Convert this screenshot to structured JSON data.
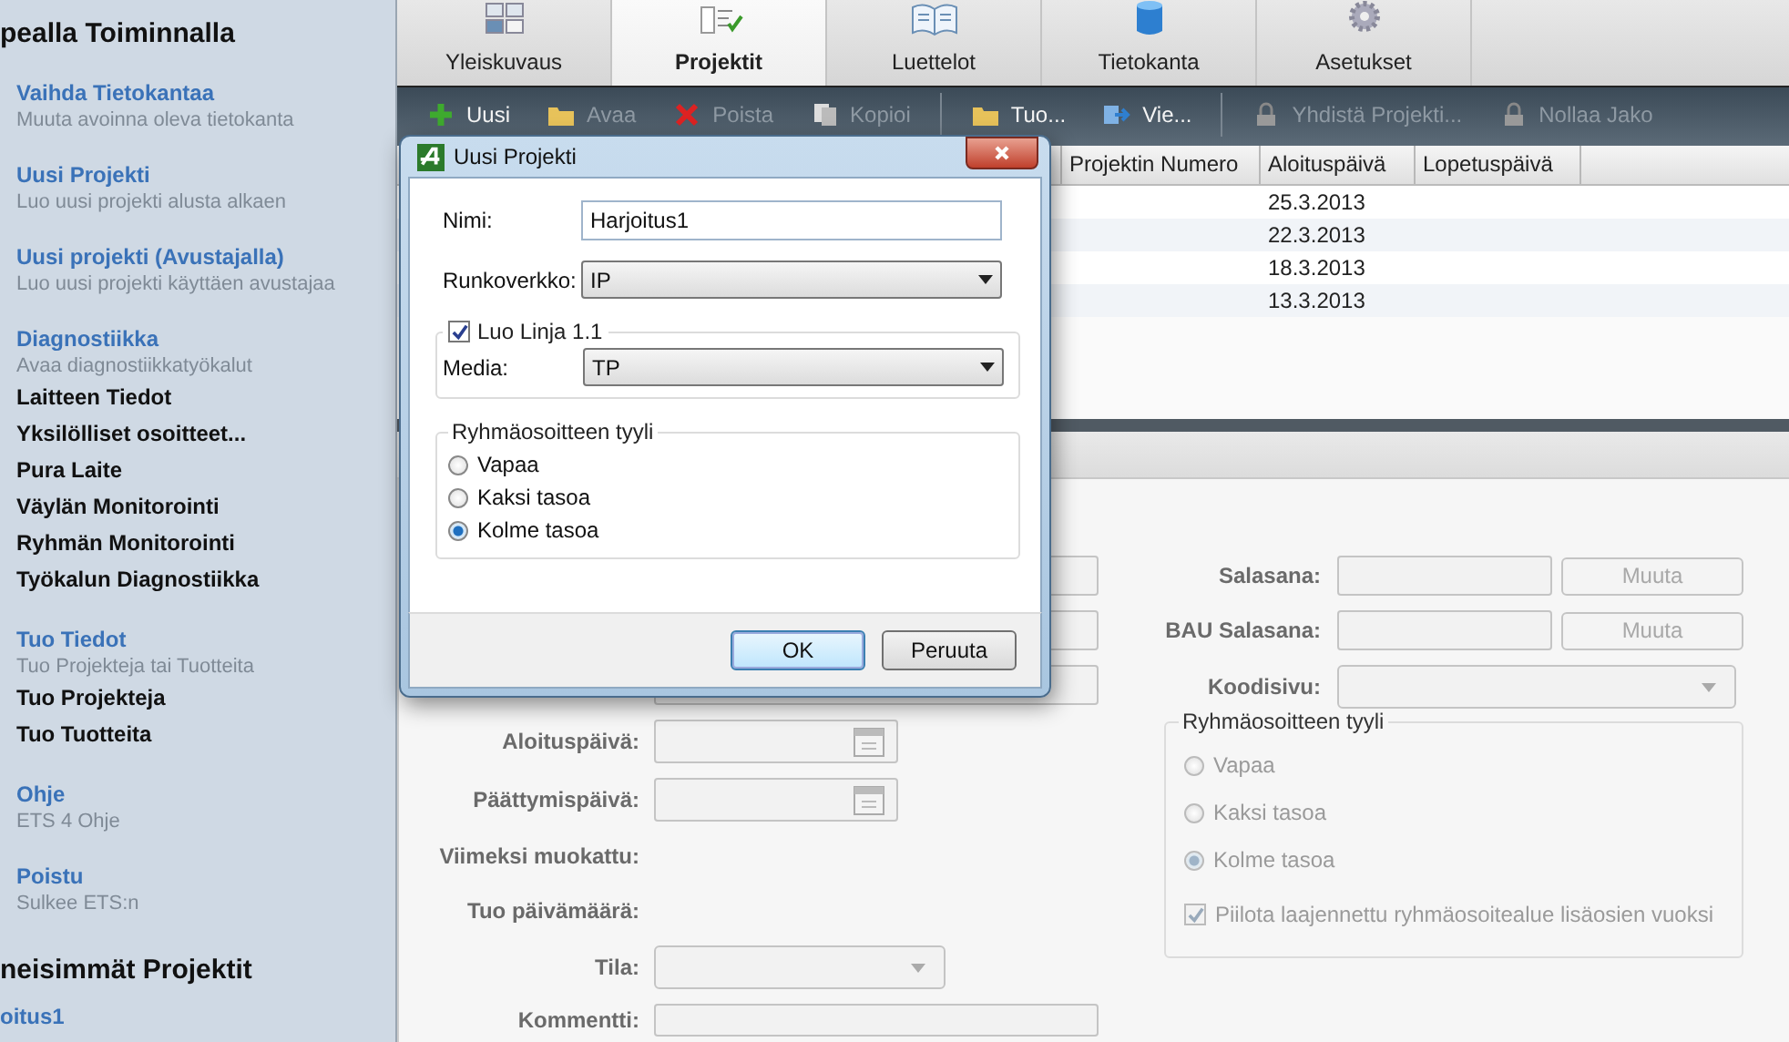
{
  "sidebar": {
    "heading": "pealla Toiminnalla",
    "sections": [
      {
        "title": "Vaihda Tietokantaa",
        "description": "Muuta avoinna oleva tietokanta"
      },
      {
        "title": "Uusi Projekti",
        "description": "Luo uusi projekti alusta alkaen"
      },
      {
        "title": "Uusi projekti (Avustajalla)",
        "description": "Luo uusi projekti käyttäen avustajaa"
      },
      {
        "title": "Diagnostiikka",
        "description": "Avaa diagnostiikkatyökalut",
        "items": [
          "Laitteen Tiedot",
          "Yksilölliset osoitteet...",
          "Pura Laite",
          "Väylän Monitorointi",
          "Ryhmän Monitorointi",
          "Työkalun Diagnostiikka"
        ]
      },
      {
        "title": "Tuo Tiedot",
        "description": "Tuo Projekteja tai Tuotteita",
        "items": [
          "Tuo Projekteja",
          "Tuo Tuotteita"
        ]
      },
      {
        "title": "Ohje",
        "description": "ETS 4 Ohje"
      },
      {
        "title": "Poistu",
        "description": "Sulkee ETS:n"
      }
    ],
    "recent_heading": "neisimmät Projektit",
    "recent_projects": [
      "oitus1"
    ]
  },
  "tabs": [
    {
      "label": "Yleiskuvaus",
      "selected": false
    },
    {
      "label": "Projektit",
      "selected": true
    },
    {
      "label": "Luettelot",
      "selected": false
    },
    {
      "label": "Tietokanta",
      "selected": false
    },
    {
      "label": "Asetukset",
      "selected": false
    }
  ],
  "toolbar": {
    "groups": [
      [
        {
          "label": "Uusi",
          "disabled": false
        },
        {
          "label": "Avaa",
          "disabled": true
        },
        {
          "label": "Poista",
          "disabled": true
        },
        {
          "label": "Kopioi",
          "disabled": true
        }
      ],
      [
        {
          "label": "Tuo...",
          "disabled": false
        },
        {
          "label": "Vie...",
          "disabled": false
        }
      ],
      [
        {
          "label": "Yhdistä Projekti...",
          "disabled": true
        },
        {
          "label": "Nollaa Jako",
          "disabled": true
        }
      ]
    ]
  },
  "table": {
    "columns": [
      "Projektin Numero",
      "Aloituspäivä",
      "Lopetuspäivä"
    ],
    "rows": [
      {
        "start_date": "25.3.2013"
      },
      {
        "start_date": "22.3.2013"
      },
      {
        "start_date": "18.3.2013"
      },
      {
        "start_date": "13.3.2013"
      }
    ]
  },
  "details": {
    "disabled": true,
    "left_rows": [
      {
        "kind": "text"
      },
      {
        "kind": "text"
      },
      {
        "kind": "text"
      },
      {
        "kind": "date",
        "label": "Aloituspäivä:"
      },
      {
        "kind": "date",
        "label": "Päättymispäivä:"
      },
      {
        "kind": "info",
        "label": "Viimeksi muokattu:"
      },
      {
        "kind": "info",
        "label": "Tuo päivämäärä:"
      },
      {
        "kind": "select",
        "label": "Tila:"
      },
      {
        "kind": "text",
        "label": "Kommentti:"
      }
    ],
    "right_rows": [
      {
        "kind": "password",
        "label": "Salasana:",
        "button": "Muuta"
      },
      {
        "kind": "password",
        "label": "BAU Salasana:",
        "button": "Muuta"
      },
      {
        "kind": "select",
        "label": "Koodisivu:"
      }
    ],
    "group_style": {
      "legend": "Ryhmäosoitteen tyyli",
      "options": [
        {
          "label": "Vapaa",
          "selected": false
        },
        {
          "label": "Kaksi tasoa",
          "selected": false
        },
        {
          "label": "Kolme tasoa",
          "selected": true
        }
      ],
      "checkbox": {
        "label": "Piilota laajennettu ryhmäosoitealue lisäosien vuoksi",
        "checked": true
      }
    }
  },
  "dialog": {
    "title": "Uusi Projekti",
    "name_label": "Nimi:",
    "name_value": "Harjoitus1",
    "backbone_label": "Runkoverkko:",
    "backbone_value": "IP",
    "line": {
      "label": "Luo Linja 1.1",
      "checked": true,
      "media_label": "Media:",
      "media_value": "TP"
    },
    "group_style": {
      "legend": "Ryhmäosoitteen tyyli",
      "options": [
        {
          "label": "Vapaa",
          "selected": false
        },
        {
          "label": "Kaksi tasoa",
          "selected": false
        },
        {
          "label": "Kolme tasoa",
          "selected": true
        }
      ]
    },
    "buttons": [
      {
        "label": "OK",
        "default": true
      },
      {
        "label": "Peruuta",
        "default": false
      }
    ]
  }
}
